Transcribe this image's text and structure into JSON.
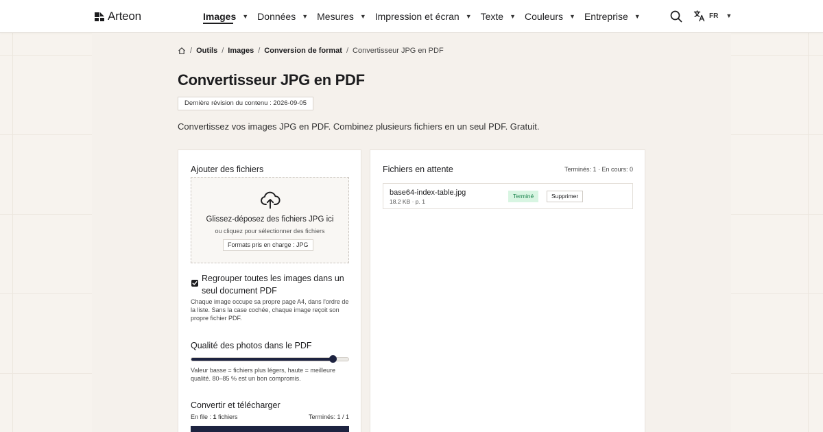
{
  "header": {
    "brand": "Arteon",
    "nav": [
      {
        "label": "Images",
        "active": true
      },
      {
        "label": "Données"
      },
      {
        "label": "Mesures"
      },
      {
        "label": "Impression et écran"
      },
      {
        "label": "Texte"
      },
      {
        "label": "Couleurs"
      },
      {
        "label": "Entreprise"
      }
    ],
    "language": "FR"
  },
  "breadcrumb": {
    "items": [
      "Outils",
      "Images",
      "Conversion de format"
    ],
    "current": "Convertisseur JPG en PDF"
  },
  "page": {
    "title": "Convertisseur JPG en PDF",
    "revision": "Dernière révision du contenu : 2026-09-05",
    "intro": "Convertissez vos images JPG en PDF. Combinez plusieurs fichiers en un seul PDF. Gratuit."
  },
  "upload": {
    "title": "Ajouter des fichiers",
    "drop_title": "Glissez-déposez des fichiers JPG ici",
    "drop_sub": "ou cliquez pour sélectionner des fichiers",
    "formats": "Formats pris en charge : JPG"
  },
  "options": {
    "merge_label": "Regrouper toutes les images dans un seul document PDF",
    "merge_checked": true,
    "merge_help": "Chaque image occupe sa propre page A4, dans l'ordre de la liste. Sans la case cochée, chaque image reçoit son propre fichier PDF.",
    "quality_title": "Qualité des photos dans le PDF",
    "quality_level": 0.9,
    "quality_help": "Valeur basse = fichiers plus légers, haute = meilleure qualité. 80–85 % est un bon compromis."
  },
  "convert": {
    "title": "Convertir et télécharger",
    "queue_prefix": "En file : ",
    "queue_count": "1",
    "queue_suffix": " fichiers",
    "done": "Terminés: 1 / 1"
  },
  "queue": {
    "title": "Fichiers en attente",
    "stats": "Terminés: 1 · En cours: 0",
    "files": [
      {
        "name": "base64-index-table.jpg",
        "meta": "18.2 KB · p. 1",
        "status": "Terminé",
        "delete_label": "Supprimer"
      }
    ]
  },
  "colors": {
    "accent": "#1d2340",
    "status_done_bg": "#d8f5e2",
    "status_done_text": "#17814a"
  },
  "icons": [
    "arteon-logo-icon",
    "search-icon",
    "translate-icon",
    "home-icon",
    "upload-cloud-icon",
    "check-icon"
  ]
}
